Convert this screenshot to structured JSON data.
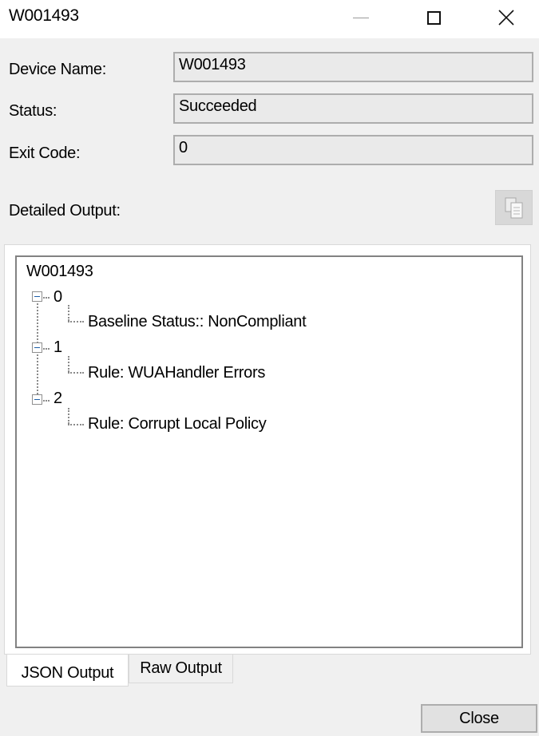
{
  "window": {
    "title": "W001493"
  },
  "fields": {
    "device_name_label": "Device Name:",
    "device_name_value": "W001493",
    "status_label": "Status:",
    "status_value": "Succeeded",
    "exit_code_label": "Exit Code:",
    "exit_code_value": "0"
  },
  "output": {
    "label": "Detailed Output:",
    "copy_icon": "copy-icon"
  },
  "tree": {
    "root": "W001493",
    "nodes": [
      {
        "label": "0",
        "child": "Baseline Status:: NonCompliant"
      },
      {
        "label": "1",
        "child": "Rule: WUAHandler Errors"
      },
      {
        "label": "2",
        "child": "Rule: Corrupt Local Policy"
      }
    ]
  },
  "tabs": [
    {
      "label": "JSON Output"
    },
    {
      "label": "Raw Output"
    }
  ],
  "buttons": {
    "close": "Close"
  },
  "colors": {
    "background": "#f0f0f0",
    "field_bg": "#eaeaea",
    "field_border": "#adadad",
    "expander_accent": "#1e5fa8"
  }
}
